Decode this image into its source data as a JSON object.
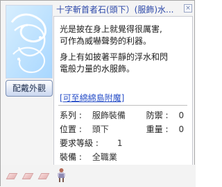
{
  "title": "十字斬首者石(頭下）(服飾)水...",
  "wear_button": "配戴外觀",
  "description": {
    "lines": [
      "光是披在身上就覺得很厲害,",
      "可作為威嚇聲勢的利器。",
      "身上有如披著平靜的浮水和閃",
      "電般力量的水服飾。"
    ]
  },
  "link": "[可至綿綿島附魔]",
  "stats": {
    "type_label": "系列 :",
    "type_value": "服飾裝備",
    "defense_label": "防禦 :",
    "defense_value": "0",
    "position_label": "位置 :",
    "position_value": "頭下",
    "weight_label": "重量 :",
    "weight_value": "0",
    "level_label": "要求等級 :",
    "level_value": "1",
    "equip_label": "裝備 :",
    "equip_value": "全職業"
  }
}
